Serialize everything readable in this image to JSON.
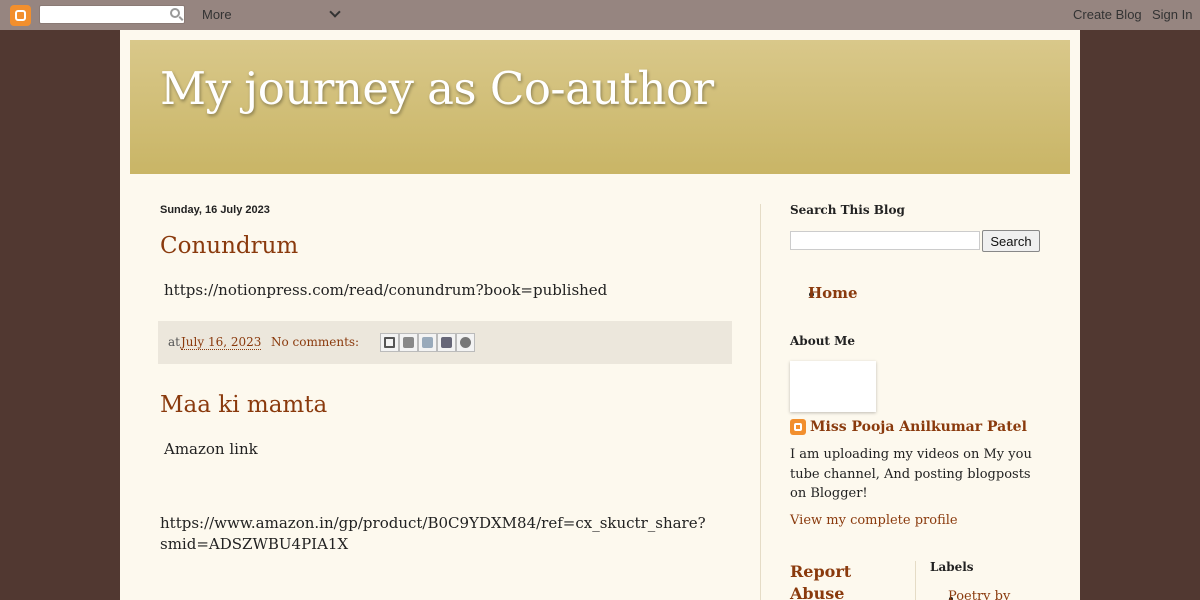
{
  "navbar": {
    "search_value": "",
    "more_label": "More",
    "create_blog": "Create Blog",
    "sign_in": "Sign In"
  },
  "blog": {
    "title": "My journey as Co-author"
  },
  "main": {
    "date_header": "Sunday, 16 July 2023",
    "posts": [
      {
        "title": "Conundrum",
        "body": "https://notionpress.com/read/conundrum?book=published",
        "footer": {
          "at_label": "at",
          "time": "July 16, 2023",
          "comments": "No comments:"
        }
      },
      {
        "title": "Maa ki mamta",
        "body_line1": "Amazon link",
        "body_line2": "https://www.amazon.in/gp/product/B0C9YDXM84/ref=cx_skuctr_share?",
        "body_line3": "smid=ADSZWBU4PIA1X"
      }
    ]
  },
  "share_icons": [
    "email-icon",
    "blogthis-icon",
    "twitter-icon",
    "facebook-icon",
    "pinterest-icon"
  ],
  "sidebar": {
    "search_heading": "Search This Blog",
    "search_value": "",
    "search_button": "Search",
    "pages": [
      "Home"
    ],
    "about_heading": "About Me",
    "profile_name": "Miss Pooja Anilkumar Patel",
    "about_text": "I am uploading my videos on My you tube channel, And posting blogposts on Blogger!",
    "view_profile": "View my complete profile",
    "report_abuse": "Report Abuse",
    "labels_heading": "Labels",
    "labels": [
      "Poetry by"
    ]
  },
  "colors": {
    "background": "#513831",
    "link": "#8a3a0d",
    "header_gradient_top": "#d9c88a",
    "header_gradient_bottom": "#c9b566",
    "page": "#fdf9ee"
  }
}
